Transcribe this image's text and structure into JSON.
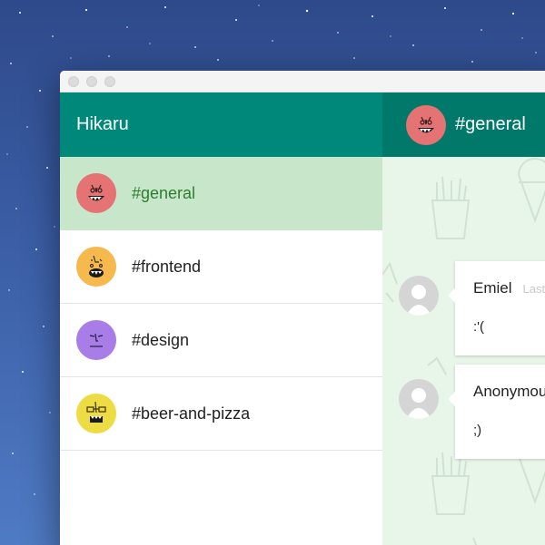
{
  "window": {
    "title_dots": [
      "close",
      "minimize",
      "zoom"
    ]
  },
  "sidebar": {
    "user_name": "Hikaru",
    "channels": [
      {
        "name": "#general",
        "active": true,
        "avatar_color": "#e57373",
        "icon": "red-monster-avatar-icon"
      },
      {
        "name": "#frontend",
        "active": false,
        "avatar_color": "#f6b94e",
        "icon": "orange-monster-avatar-icon"
      },
      {
        "name": "#design",
        "active": false,
        "avatar_color": "#a97de8",
        "icon": "purple-monster-avatar-icon"
      },
      {
        "name": "#beer-and-pizza",
        "active": false,
        "avatar_color": "#eedc45",
        "icon": "yellow-monster-avatar-icon"
      }
    ]
  },
  "main": {
    "channel_title": "#general",
    "channel_icon": "red-monster-avatar-icon",
    "messages": [
      {
        "author": "Emiel",
        "time": "Last",
        "text": ":'(",
        "avatar_icon": "user-placeholder-icon"
      },
      {
        "author": "Anonymous",
        "time": "",
        "text": ";)",
        "avatar_icon": "user-placeholder-icon"
      }
    ]
  },
  "colors": {
    "sidebar_header": "#00897b",
    "main_header": "#00796b",
    "active_channel_bg": "#c8e6c9",
    "active_channel_text": "#2e7d32",
    "chat_bg": "#e8f5e9"
  }
}
